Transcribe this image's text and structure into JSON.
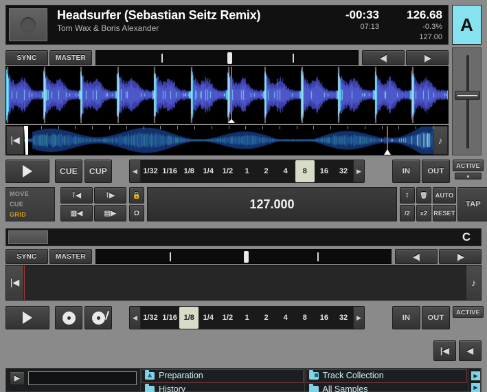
{
  "deck_a": {
    "title": "Headsurfer (Sebastian Seitz Remix)",
    "artist": "Tom Wax & Boris Alexander",
    "remain_time": "-00:33",
    "total_time": "07:13",
    "bpm": "126.68",
    "pitch": "-0.3%",
    "base_bpm": "127.00",
    "deck_letter": "A",
    "sync_label": "SYNC",
    "master_label": "MASTER",
    "nudge_back": "◀|",
    "nudge_fwd": "|▶",
    "play_icon": "play-triangle",
    "cue_label": "CUE",
    "cup_label": "CUP",
    "loop_sizes": [
      "1/32",
      "1/16",
      "1/8",
      "1/4",
      "1/2",
      "1",
      "2",
      "4",
      "8",
      "16",
      "32"
    ],
    "loop_selected": "8",
    "loop_prev": "◀",
    "loop_next": "▶",
    "in_label": "IN",
    "out_label": "OUT",
    "active_label": "ACTIVE",
    "active_arrow": "▲"
  },
  "advanced": {
    "tabs": [
      "MOVE",
      "CUE",
      "GRID"
    ],
    "tab_selected": "GRID",
    "grid_nudge": [
      "⊺◀",
      "⊺▶",
      "▥◀",
      "▤▶"
    ],
    "lock_icon": "lock-icon",
    "headphone_icon": "headphone-icon",
    "bpm_value": "127.000",
    "right_buttons": [
      "⊺",
      "trash-icon",
      "AUTO",
      "/2",
      "x2",
      "RESET"
    ],
    "tap_label": "TAP"
  },
  "deck_b": {
    "deck_letter": "C",
    "sync_label": "SYNC",
    "master_label": "MASTER",
    "nudge_back": "◀|",
    "nudge_fwd": "|▶",
    "play_icon": "play-triangle",
    "vinyl_icon": "vinyl-icon",
    "vinyl_arm_icon": "vinyl-tonearm-icon",
    "loop_sizes": [
      "1/32",
      "1/16",
      "1/8",
      "1/4",
      "1/2",
      "1",
      "2",
      "4",
      "8",
      "16",
      "32"
    ],
    "loop_selected": "1/8",
    "loop_prev": "◀",
    "loop_next": "▶",
    "in_label": "IN",
    "out_label": "OUT",
    "active_label": "ACTIVE"
  },
  "nav": {
    "first_label": "|◀",
    "prev_label": "◀"
  },
  "browser": {
    "search_go": "▶",
    "search_value": "",
    "search_placeholder": "",
    "tree_col1": [
      {
        "label": "Preparation",
        "icon": "folder-preparation-icon"
      },
      {
        "label": "History",
        "icon": "folder-icon"
      }
    ],
    "tree_col2": [
      {
        "label": "Track Collection",
        "icon": "folder-collection-icon"
      },
      {
        "label": "All Samples",
        "icon": "folder-icon"
      }
    ]
  },
  "colors": {
    "deck_accent": "#86e2ee",
    "playhead": "#e0472c",
    "grid_tab_active": "#d79a22",
    "loop_selected_bg": "#d6dcc6",
    "panel_bg": "#8a8a8a"
  }
}
